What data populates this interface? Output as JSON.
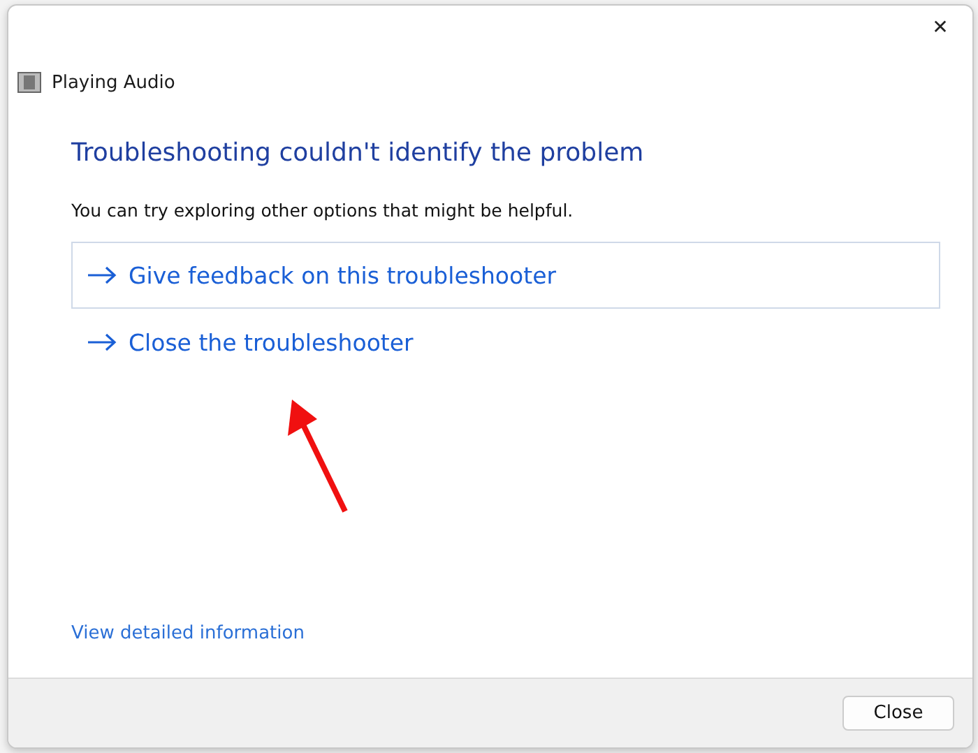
{
  "window": {
    "title": "Playing Audio",
    "close_glyph": "✕"
  },
  "heading": "Troubleshooting couldn't identify the problem",
  "description": "You can try exploring other options that might be helpful.",
  "options": [
    {
      "label": "Give feedback on this troubleshooter",
      "focused": true
    },
    {
      "label": "Close the troubleshooter",
      "focused": false
    }
  ],
  "details_link": "View detailed information",
  "buttons": [
    "Close"
  ]
}
